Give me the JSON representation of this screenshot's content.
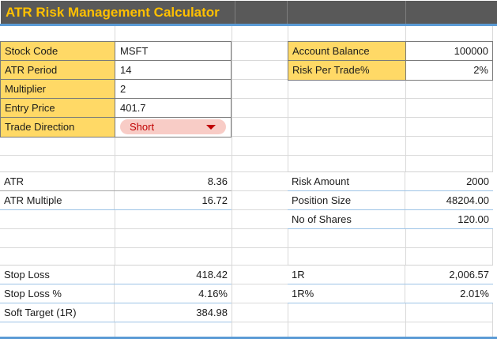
{
  "header": {
    "title": "ATR Risk Management Calculator"
  },
  "left_inputs": {
    "rows": [
      {
        "label": "Stock Code",
        "value": "MSFT"
      },
      {
        "label": "ATR Period",
        "value": "14"
      },
      {
        "label": "Multiplier",
        "value": "2"
      },
      {
        "label": "Entry Price",
        "value": "401.7"
      },
      {
        "label": "Trade Direction",
        "value": "Short"
      }
    ]
  },
  "right_inputs": {
    "rows": [
      {
        "label": "Account Balance",
        "value": "100000"
      },
      {
        "label": "Risk Per Trade%",
        "value": "2%"
      }
    ]
  },
  "atr_outputs": {
    "rows": [
      {
        "label": "ATR",
        "value": "8.36"
      },
      {
        "label": "ATR Multiple",
        "value": "16.72"
      }
    ]
  },
  "position_outputs": {
    "rows": [
      {
        "label": "Risk Amount",
        "value": "2000"
      },
      {
        "label": "Position Size",
        "value": "48204.00"
      },
      {
        "label": "No of Shares",
        "value": "120.00"
      }
    ]
  },
  "stop_outputs": {
    "rows": [
      {
        "label": "Stop Loss",
        "value": "418.42"
      },
      {
        "label": "Stop Loss %",
        "value": "4.16%"
      },
      {
        "label": "Soft Target (1R)",
        "value": "384.98"
      }
    ]
  },
  "r_outputs": {
    "rows": [
      {
        "label": "1R",
        "value": "2,006.57"
      },
      {
        "label": "1R%",
        "value": "2.01%"
      }
    ]
  },
  "icons": {
    "trade_direction_dropdown": "triangle-down-icon"
  },
  "colors": {
    "header_bg": "#595959",
    "header_text": "#FFC000",
    "label_bg": "#FFD966",
    "block_border": "#7a7a7a",
    "gridline": "#d9d9d9",
    "thin_blue": "#9DC3E6",
    "thick_blue": "#5B9BD5",
    "pill_bg": "#F8CCC6",
    "pill_accent": "#C00000",
    "atr_divider": "#a6a6a6",
    "text": "#1b1b1b"
  }
}
